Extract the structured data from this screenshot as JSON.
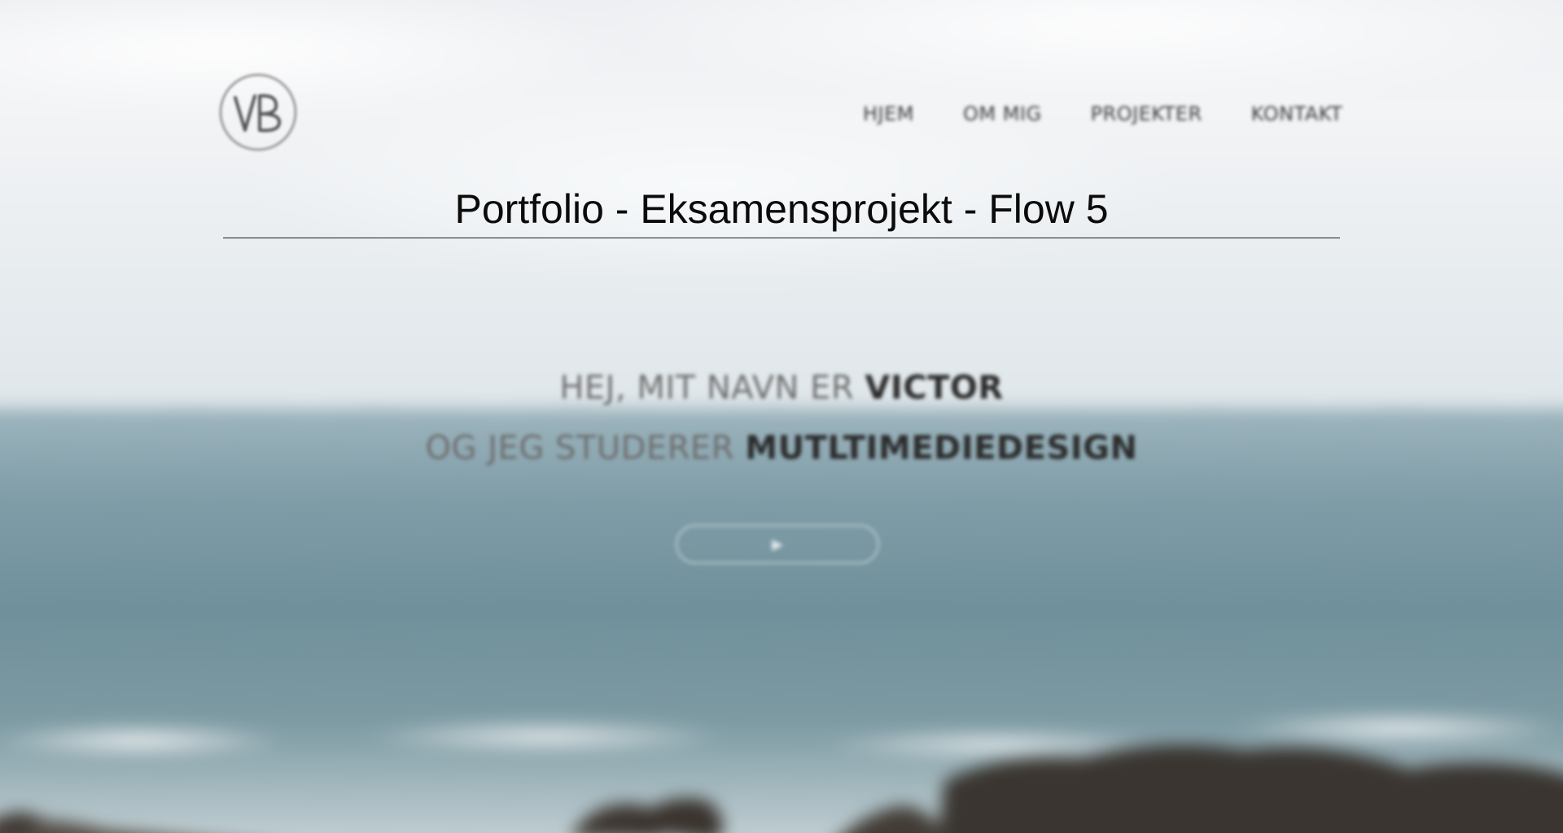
{
  "header": {
    "logo_text": "VB",
    "nav": [
      {
        "label": "HJEM"
      },
      {
        "label": "OM MIG"
      },
      {
        "label": "PROJEKTER"
      },
      {
        "label": "KONTAKT"
      }
    ]
  },
  "overlay": {
    "title": "Portfolio - Eksamensprojekt - Flow 5"
  },
  "hero": {
    "line1_prefix": "HEJ, MIT NAVN ER",
    "line1_highlight": "VICTOR",
    "line2_prefix": "OG JEG STUDERER",
    "line2_highlight": "MUTLTIMEDIEDESIGN",
    "cta_icon": "play-icon"
  },
  "colors": {
    "title_text": "#0b0b0b",
    "nav_text": "#3a3a3a",
    "sea": "#7f9ea9",
    "sky": "#eceef1"
  }
}
